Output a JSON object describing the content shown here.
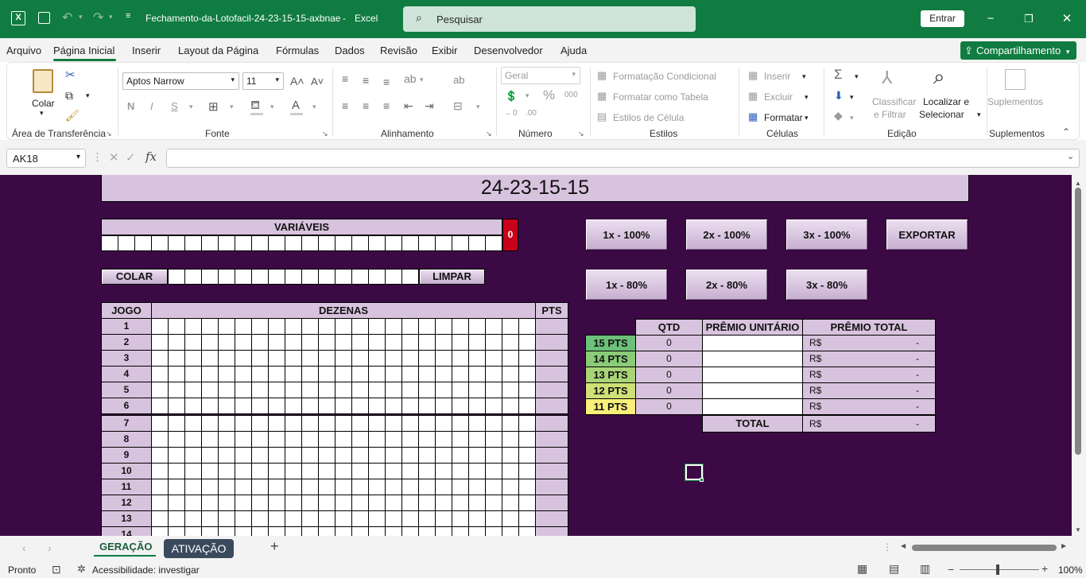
{
  "titlebar": {
    "filename": "Fechamento-da-Lotofacil-24-23-15-15-axbnae",
    "sep": "-",
    "app": "Excel",
    "search_placeholder": "Pesquisar",
    "signin": "Entrar",
    "min": "−",
    "max": "❐",
    "close": "✕"
  },
  "menu": {
    "items": [
      "Arquivo",
      "Página Inicial",
      "Inserir",
      "Layout da Página",
      "Fórmulas",
      "Dados",
      "Revisão",
      "Exibir",
      "Desenvolvedor",
      "Ajuda"
    ],
    "share": "Compartilhamento"
  },
  "ribbon": {
    "clipboard": {
      "paste": "Colar",
      "group": "Área de Transferência"
    },
    "font": {
      "name": "Aptos Narrow",
      "size": "11",
      "bold": "N",
      "italic": "I",
      "underline": "S",
      "group": "Fonte"
    },
    "alignment": {
      "group": "Alinhamento"
    },
    "number": {
      "format": "Geral",
      "percent": "%",
      "thousands": "000",
      "group": "Número"
    },
    "styles": {
      "conditional": "Formatação Condicional",
      "table": "Formatar como Tabela",
      "cell": "Estilos de Célula",
      "group": "Estilos"
    },
    "cells": {
      "insert": "Inserir",
      "delete": "Excluir",
      "format": "Formatar",
      "group": "Células"
    },
    "editing": {
      "sort1": "Classificar",
      "sort2": "e Filtrar",
      "find1": "Localizar e",
      "find2": "Selecionar",
      "group": "Edição"
    },
    "addins": {
      "label": "Suplementos",
      "group": "Suplementos"
    }
  },
  "formula": {
    "namebox": "AK18",
    "fx": "fx",
    "value": ""
  },
  "sheet": {
    "title": "24-23-15-15",
    "variaveis": "VARIÁVEIS",
    "counter": "0",
    "colar": "COLAR",
    "limpar": "LIMPAR",
    "buttons_row1": [
      "1x - 100%",
      "2x - 100%",
      "3x - 100%",
      "EXPORTAR"
    ],
    "buttons_row2": [
      "1x - 80%",
      "2x - 80%",
      "3x - 80%"
    ],
    "table_headers": {
      "jogo": "JOGO",
      "dezenas": "DEZENAS",
      "pts": "PTS"
    },
    "jogos": [
      "1",
      "2",
      "3",
      "4",
      "5",
      "6",
      "7",
      "8",
      "9",
      "10",
      "11",
      "12",
      "13",
      "14"
    ],
    "prize_headers": {
      "qtd": "QTD",
      "unit": "PRÊMIO UNITÁRIO",
      "total": "PRÊMIO TOTAL"
    },
    "prizes": [
      {
        "label": "15 PTS",
        "qtd": "0",
        "cur": "R$",
        "val": "-",
        "color": "#6cc07a"
      },
      {
        "label": "14 PTS",
        "qtd": "0",
        "cur": "R$",
        "val": "-",
        "color": "#8acb78"
      },
      {
        "label": "13 PTS",
        "qtd": "0",
        "cur": "R$",
        "val": "-",
        "color": "#a9d476"
      },
      {
        "label": "12 PTS",
        "qtd": "0",
        "cur": "R$",
        "val": "-",
        "color": "#cfe076"
      },
      {
        "label": "11 PTS",
        "qtd": "0",
        "cur": "R$",
        "val": "-",
        "color": "#f7ef78"
      }
    ],
    "total_label": "TOTAL",
    "total_cur": "R$",
    "total_val": "-"
  },
  "tabs": {
    "items": [
      "GERAÇÃO",
      "ATIVAÇÃO"
    ],
    "add": "+"
  },
  "status": {
    "ready": "Pronto",
    "accessibility": "Acessibilidade: investigar",
    "zoom": "100%"
  }
}
